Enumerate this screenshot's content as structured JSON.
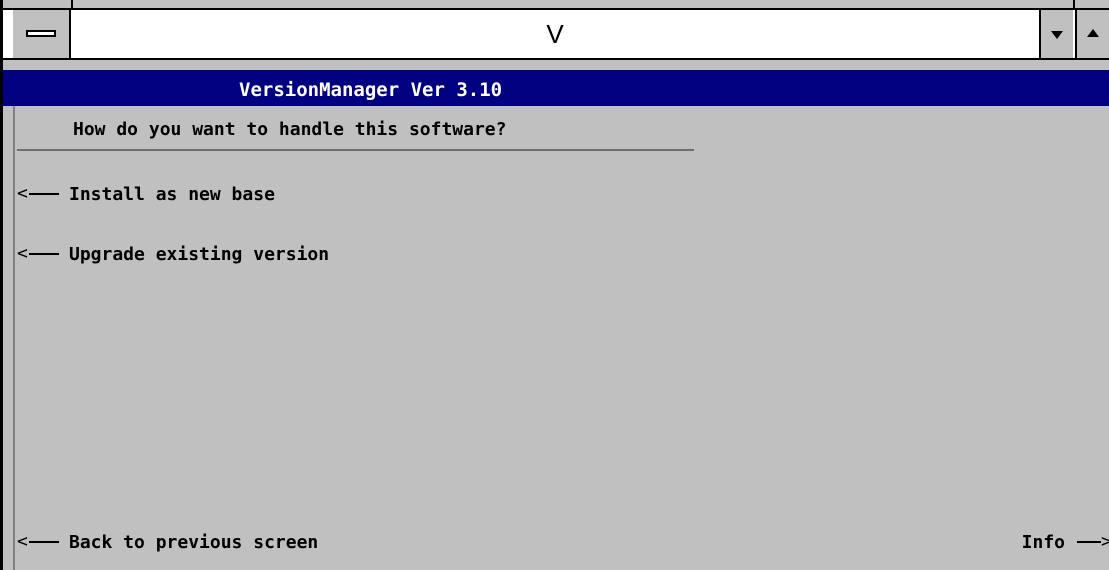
{
  "window": {
    "title": "V"
  },
  "header": {
    "title": "VersionManager Ver 3.10"
  },
  "prompt": {
    "question": "How do you want to handle this software?"
  },
  "options": [
    {
      "arrow": "<",
      "label": "Install as new base"
    },
    {
      "arrow": "<",
      "label": "Upgrade existing version"
    }
  ],
  "footer": {
    "back_arrow": "<",
    "back_label": "Back to previous screen",
    "info_label": "Info",
    "info_arrow": ">"
  },
  "colors": {
    "face": "#c0c0c0",
    "header_band": "#000080",
    "header_text": "#ffffff"
  },
  "icons": {
    "system_menu": "system-menu-icon",
    "minimize": "triangle-down-icon",
    "maximize": "triangle-up-icon",
    "left_arrow": "left-arrow-icon",
    "right_arrow": "right-arrow-icon"
  }
}
